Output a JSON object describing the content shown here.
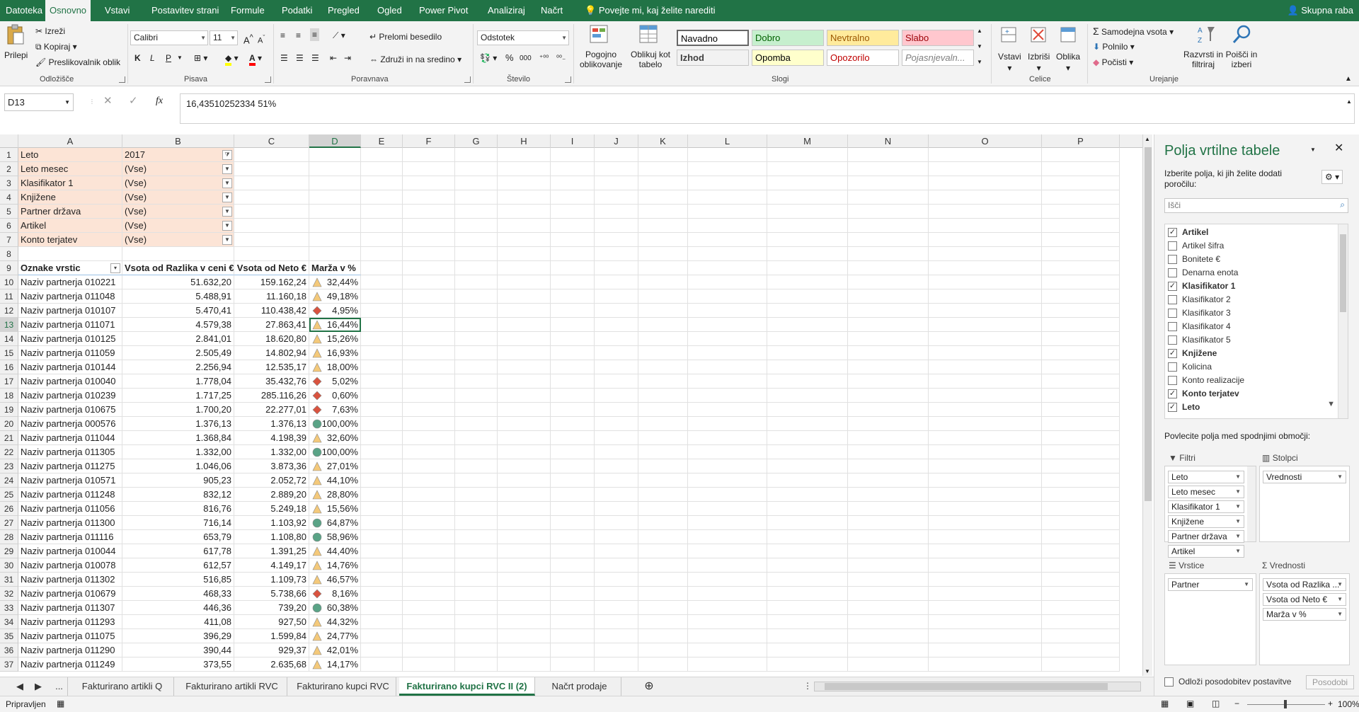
{
  "ribbon_tabs": [
    "Datoteka",
    "Osnovno",
    "Vstavi",
    "Postavitev strani",
    "Formule",
    "Podatki",
    "Pregled",
    "Ogled",
    "Power Pivot",
    "Analiziraj",
    "Načrt"
  ],
  "active_tab": "Osnovno",
  "tell_me": "Povejte mi, kaj želite narediti",
  "share": "Skupna raba",
  "clipboard": {
    "paste": "Prilepi",
    "cut": "Izreži",
    "copy": "Kopiraj",
    "format_painter": "Preslikovalnik oblik",
    "label": "Odložišče"
  },
  "font": {
    "name": "Calibri",
    "size": "11",
    "bold": "K",
    "italic": "L",
    "underline": "P",
    "label": "Pisava"
  },
  "alignment": {
    "wrap": "Prelomi besedilo",
    "merge": "Združi in na sredino",
    "label": "Poravnava"
  },
  "number": {
    "format": "Odstotek",
    "percent": "%",
    "thousands": "000",
    "label": "Število"
  },
  "cond": {
    "conditional": "Pogojno oblikovanje",
    "format_table": "Oblikuj kot tabelo"
  },
  "styles": {
    "label": "Slogi",
    "cells": [
      {
        "name": "Navadno",
        "bg": "#ffffff",
        "fg": "#000000"
      },
      {
        "name": "Dobro",
        "bg": "#c6efce",
        "fg": "#006100"
      },
      {
        "name": "Nevtralno",
        "bg": "#ffeb9c",
        "fg": "#9c5700"
      },
      {
        "name": "Slabo",
        "bg": "#ffc7ce",
        "fg": "#9c0006"
      },
      {
        "name": "Izhod",
        "bg": "#f2f2f2",
        "fg": "#3f3f3f"
      },
      {
        "name": "Opomba",
        "bg": "#ffffcc",
        "fg": "#000000"
      },
      {
        "name": "Opozorilo",
        "bg": "#ffffff",
        "fg": "#c00000"
      },
      {
        "name": "Pojasnjevaln...",
        "bg": "#ffffff",
        "fg": "#7f7f7f"
      }
    ]
  },
  "cells_grp": {
    "insert": "Vstavi",
    "delete": "Izbriši",
    "format": "Oblika",
    "label": "Celice"
  },
  "editing": {
    "autosum": "Samodejna vsota",
    "fill": "Polnilo",
    "clear": "Počisti",
    "sort": "Razvrsti in filtriraj",
    "find": "Poišči in izberi",
    "label": "Urejanje"
  },
  "formula": {
    "namebox": "D13",
    "fx": "fx",
    "content": "16,43510252334 51%"
  },
  "columns": [
    "A",
    "B",
    "C",
    "D",
    "E",
    "F",
    "G",
    "H",
    "I",
    "J",
    "K",
    "L",
    "M",
    "N",
    "O",
    "P"
  ],
  "filters": [
    {
      "label": "Leto",
      "value": "2017",
      "filtered": true
    },
    {
      "label": "Leto mesec",
      "value": "(Vse)"
    },
    {
      "label": "Klasifikator 1",
      "value": "(Vse)"
    },
    {
      "label": "Knjižene",
      "value": "(Vse)"
    },
    {
      "label": "Partner država",
      "value": "(Vse)"
    },
    {
      "label": "Artikel",
      "value": "(Vse)"
    },
    {
      "label": "Konto terjatev",
      "value": "(Vse)"
    }
  ],
  "table_headers": [
    "Oznake vrstic",
    "Vsota od Razlika v ceni €",
    "Vsota od Neto €",
    "Marža v %"
  ],
  "rows": [
    [
      "Naziv partnerja 010221",
      "51.632,20",
      "159.162,24",
      "tri",
      "32,44%"
    ],
    [
      "Naziv partnerja 011048",
      "5.488,91",
      "11.160,18",
      "tri",
      "49,18%"
    ],
    [
      "Naziv partnerja 010107",
      "5.470,41",
      "110.438,42",
      "dia",
      "4,95%"
    ],
    [
      "Naziv partnerja 011071",
      "4.579,38",
      "27.863,41",
      "tri",
      "16,44%"
    ],
    [
      "Naziv partnerja 010125",
      "2.841,01",
      "18.620,80",
      "tri",
      "15,26%"
    ],
    [
      "Naziv partnerja 011059",
      "2.505,49",
      "14.802,94",
      "tri",
      "16,93%"
    ],
    [
      "Naziv partnerja 010144",
      "2.256,94",
      "12.535,17",
      "tri",
      "18,00%"
    ],
    [
      "Naziv partnerja 010040",
      "1.778,04",
      "35.432,76",
      "dia",
      "5,02%"
    ],
    [
      "Naziv partnerja 010239",
      "1.717,25",
      "285.116,26",
      "dia",
      "0,60%"
    ],
    [
      "Naziv partnerja 010675",
      "1.700,20",
      "22.277,01",
      "dia",
      "7,63%"
    ],
    [
      "Naziv partnerja 000576",
      "1.376,13",
      "1.376,13",
      "circ",
      "100,00%"
    ],
    [
      "Naziv partnerja 011044",
      "1.368,84",
      "4.198,39",
      "tri",
      "32,60%"
    ],
    [
      "Naziv partnerja 011305",
      "1.332,00",
      "1.332,00",
      "circ",
      "100,00%"
    ],
    [
      "Naziv partnerja 011275",
      "1.046,06",
      "3.873,36",
      "tri",
      "27,01%"
    ],
    [
      "Naziv partnerja 010571",
      "905,23",
      "2.052,72",
      "tri",
      "44,10%"
    ],
    [
      "Naziv partnerja 011248",
      "832,12",
      "2.889,20",
      "tri",
      "28,80%"
    ],
    [
      "Naziv partnerja 011056",
      "816,76",
      "5.249,18",
      "tri",
      "15,56%"
    ],
    [
      "Naziv partnerja 011300",
      "716,14",
      "1.103,92",
      "circ",
      "64,87%"
    ],
    [
      "Naziv partnerja 011116",
      "653,79",
      "1.108,80",
      "circ",
      "58,96%"
    ],
    [
      "Naziv partnerja 010044",
      "617,78",
      "1.391,25",
      "tri",
      "44,40%"
    ],
    [
      "Naziv partnerja 010078",
      "612,57",
      "4.149,17",
      "tri",
      "14,76%"
    ],
    [
      "Naziv partnerja 011302",
      "516,85",
      "1.109,73",
      "tri",
      "46,57%"
    ],
    [
      "Naziv partnerja 010679",
      "468,33",
      "5.738,66",
      "dia",
      "8,16%"
    ],
    [
      "Naziv partnerja 011307",
      "446,36",
      "739,20",
      "circ",
      "60,38%"
    ],
    [
      "Naziv partnerja 011293",
      "411,08",
      "927,50",
      "tri",
      "44,32%"
    ],
    [
      "Naziv partnerja 011075",
      "396,29",
      "1.599,84",
      "tri",
      "24,77%"
    ],
    [
      "Naziv partnerja 011290",
      "390,44",
      "929,37",
      "tri",
      "42,01%"
    ],
    [
      "Naziv partnerja 011249",
      "373,55",
      "2.635,68",
      "tri",
      "14,17%"
    ]
  ],
  "indicator_colors": {
    "tri": "#f4c97a",
    "dia": "#d9533f",
    "circ": "#5aa386"
  },
  "sheet_tabs": [
    "...",
    "Fakturirano artikli Q",
    "Fakturirano artikli RVC",
    "Fakturirano kupci RVC",
    "Fakturirano kupci RVC II (2)",
    "Načrt prodaje"
  ],
  "active_sheet": "Fakturirano kupci RVC II (2)",
  "status": {
    "ready": "Pripravljen",
    "zoom": "100%"
  },
  "pane": {
    "title": "Polja vrtilne tabele",
    "subtitle": "Izberite polja, ki jih želite dodati poročilu:",
    "search_placeholder": "Išči",
    "fields": [
      {
        "name": "Artikel",
        "checked": true
      },
      {
        "name": "Artikel šifra",
        "checked": false
      },
      {
        "name": "Bonitete €",
        "checked": false
      },
      {
        "name": "Denarna enota",
        "checked": false
      },
      {
        "name": "Klasifikator 1",
        "checked": true
      },
      {
        "name": "Klasifikator 2",
        "checked": false
      },
      {
        "name": "Klasifikator 3",
        "checked": false
      },
      {
        "name": "Klasifikator 4",
        "checked": false
      },
      {
        "name": "Klasifikator 5",
        "checked": false
      },
      {
        "name": "Knjižene",
        "checked": true
      },
      {
        "name": "Kolicina",
        "checked": false
      },
      {
        "name": "Konto realizacije",
        "checked": false
      },
      {
        "name": "Konto terjatev",
        "checked": true
      },
      {
        "name": "Leto",
        "checked": true
      }
    ],
    "drag_label": "Povlecite polja med spodnjimi območji:",
    "filters_label": "Filtri",
    "columns_label": "Stolpci",
    "rows_label": "Vrstice",
    "values_label": "Vrednosti",
    "filter_chips": [
      "Leto",
      "Leto mesec",
      "Klasifikator 1",
      "Knjižene",
      "Partner država",
      "Artikel"
    ],
    "column_chips": [
      "Vrednosti"
    ],
    "row_chips": [
      "Partner"
    ],
    "value_chips": [
      "Vsota od Razlika ...",
      "Vsota od Neto €",
      "Marža v %"
    ],
    "defer": "Odloži posodobitev postavitve",
    "update": "Posodobi"
  }
}
